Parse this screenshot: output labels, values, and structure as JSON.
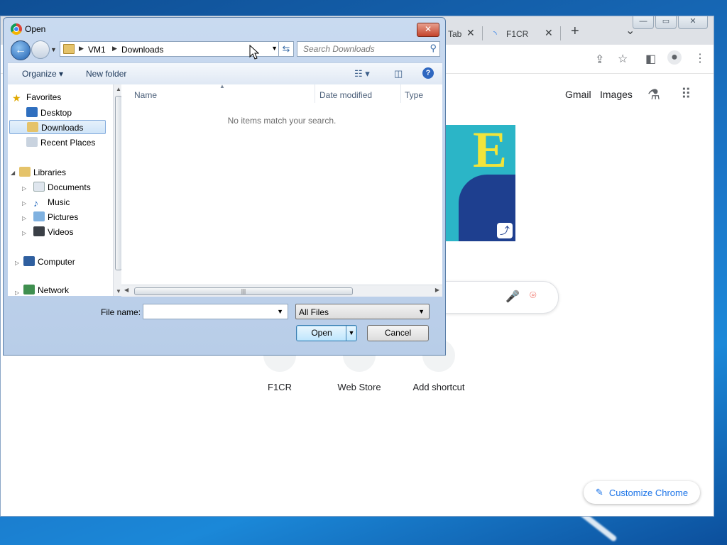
{
  "chrome": {
    "tabs": [
      {
        "label": "Tab",
        "close": "✕"
      },
      {
        "label": "F1CR",
        "close": "✕"
      }
    ],
    "new_tab": "+",
    "tab_menu": "⌄",
    "window_buttons": {
      "minimize": "—",
      "maximize": "▭",
      "close": "✕"
    },
    "header_links": {
      "gmail": "Gmail",
      "images": "Images"
    },
    "shortcuts": [
      {
        "label": "F1CR"
      },
      {
        "label": "Web Store"
      },
      {
        "label": "Add shortcut"
      }
    ],
    "customize_label": "Customize Chrome",
    "doodle_letter": "E"
  },
  "dialog": {
    "title": "Open",
    "close_glyph": "✕",
    "breadcrumb": [
      "VM1",
      "Downloads"
    ],
    "search_placeholder": "Search Downloads",
    "commands": {
      "organize": "Organize",
      "new_folder": "New folder",
      "help": "?"
    },
    "nav": {
      "favorites": "Favorites",
      "desktop": "Desktop",
      "downloads": "Downloads",
      "recent_places": "Recent Places",
      "libraries": "Libraries",
      "documents": "Documents",
      "music": "Music",
      "pictures": "Pictures",
      "videos": "Videos",
      "computer": "Computer",
      "network": "Network"
    },
    "columns": {
      "name": "Name",
      "date_modified": "Date modified",
      "type": "Type"
    },
    "empty_message": "No items match your search.",
    "file_name_label": "File name:",
    "file_name_value": "",
    "file_type": "All Files",
    "open_label": "Open",
    "cancel_label": "Cancel"
  },
  "colors": {
    "accent": "#1a73e8",
    "dialog_frame": "#b8cde8",
    "selection": "#cfe4f8"
  }
}
